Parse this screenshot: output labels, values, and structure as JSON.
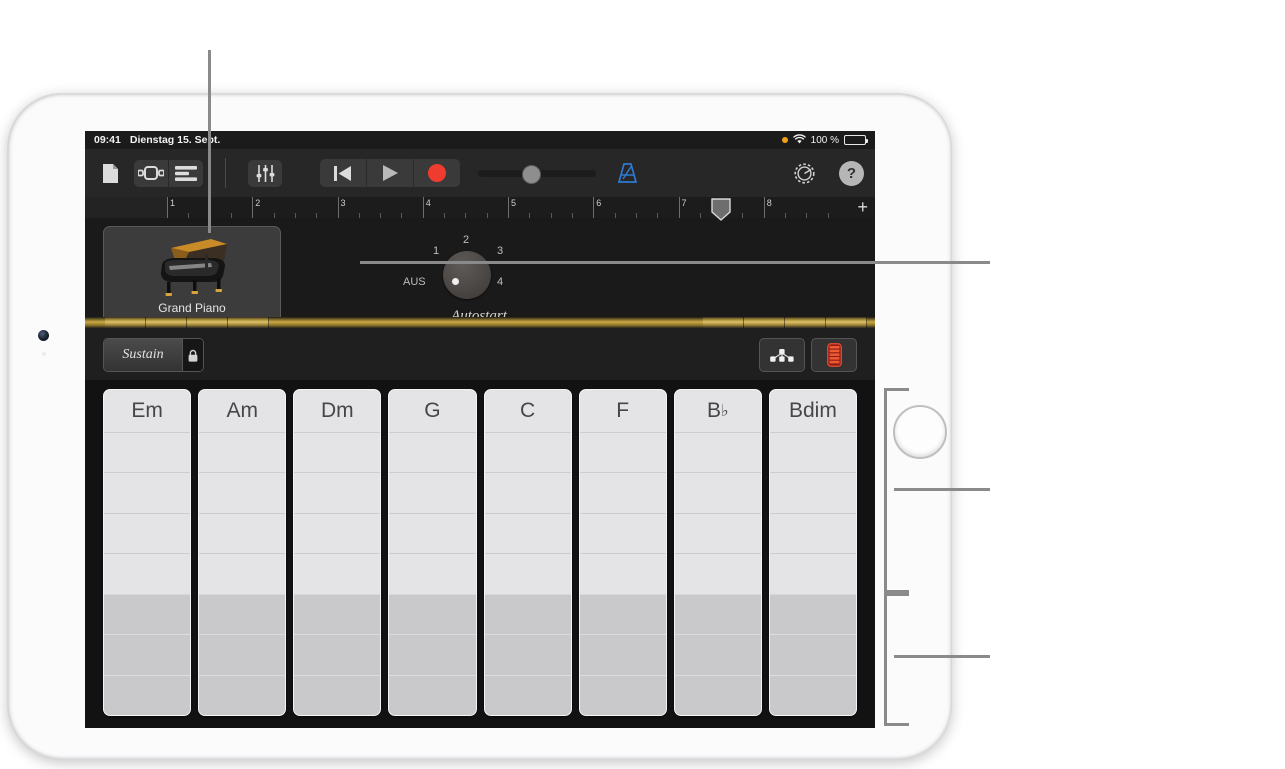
{
  "status_bar": {
    "time": "09:41",
    "date": "Dienstag 15. Sept.",
    "recording_indicator": "orange-dot",
    "wifi_icon": "wifi-icon",
    "battery_percent": "100 %",
    "battery_icon": "battery-full-icon"
  },
  "toolbar": {
    "document_button": "document-icon",
    "navigation_button": "navigation-view-icon",
    "tracks_button": "tracks-view-icon",
    "mixer_button": "mixer-faders-icon",
    "rewind_button": "rewind-to-start-icon",
    "play_button": "play-icon",
    "record_button": "record-icon",
    "position_slider_value": 44,
    "metronome_button": "metronome-icon",
    "settings_button": "settings-gear-icon",
    "help_button": "?"
  },
  "ruler": {
    "bars": [
      "1",
      "2",
      "3",
      "4",
      "5",
      "6",
      "7",
      "8"
    ],
    "playhead_bar": "7.5",
    "add_track_label": "+"
  },
  "instrument": {
    "name": "Grand Piano",
    "icon": "grand-piano-icon"
  },
  "autostart": {
    "caption": "Autostart",
    "off_label": "AUS",
    "positions": [
      "1",
      "2",
      "3",
      "4"
    ],
    "selected": "AUS"
  },
  "controls": {
    "sustain_label": "Sustain",
    "sustain_lock_icon": "lock-icon",
    "arpeggiator_button": "arpeggiator-notes-icon",
    "keyboard_toggle_button": "chord-keys-icon"
  },
  "chords": [
    {
      "name": "Em",
      "root": "Em",
      "accidental": ""
    },
    {
      "name": "Am",
      "root": "Am",
      "accidental": ""
    },
    {
      "name": "Dm",
      "root": "Dm",
      "accidental": ""
    },
    {
      "name": "G",
      "root": "G",
      "accidental": ""
    },
    {
      "name": "C",
      "root": "C",
      "accidental": ""
    },
    {
      "name": "F",
      "root": "F",
      "accidental": ""
    },
    {
      "name": "Bb",
      "root": "B",
      "accidental": "♭"
    },
    {
      "name": "Bdim",
      "root": "Bdim",
      "accidental": ""
    }
  ],
  "chord_rows": {
    "light_count": 4,
    "dark_count": 3
  },
  "colors": {
    "record_red": "#f03c2e",
    "metronome_blue": "#2e7ad1",
    "brass": "#caa845",
    "screen_bg": "#121212",
    "chord_light": "#e4e4e6",
    "chord_dark": "#c9c9cb",
    "callout_gray": "#8a8a8a"
  },
  "callouts": {
    "top_pointer": "instrument-card-callout",
    "right_pointer": "autostart-knob-callout",
    "bracket_upper": "chord-upper-region-callout",
    "bracket_lower": "chord-lower-region-callout"
  }
}
